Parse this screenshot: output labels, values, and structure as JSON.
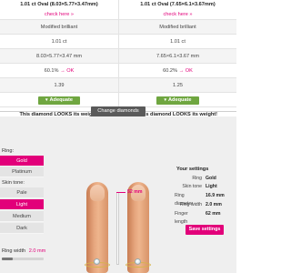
{
  "comparison": [
    {
      "title": "1.01 ct Oval (8.03×5.77×3.47mm)",
      "check_label": "check here »",
      "cut": "Modified brilliant",
      "carat": "1.01 ct",
      "dimensions": "8.03×5.77×3.47 mm",
      "ratio": "60.1%",
      "ratio_arrow": "→",
      "ratio_status": "OK",
      "lw_ratio": "1.39",
      "rating": "Adequate",
      "verdict": "This diamond LOOKS its weight!"
    },
    {
      "title": "1.01 ct Oval (7.65×6.1×3.67mm)",
      "check_label": "check here »",
      "cut": "Modified brilliant",
      "carat": "1.01 ct",
      "dimensions": "7.65×6.1×3.67 mm",
      "ratio": "60.2%",
      "ratio_arrow": "→",
      "ratio_status": "OK",
      "lw_ratio": "1.25",
      "rating": "Adequate",
      "verdict": "This diamond LOOKS its weight!"
    }
  ],
  "change_diamonds_label": "Change diamonds",
  "ring": {
    "label": "Ring:",
    "options": [
      "Gold",
      "Platinum"
    ],
    "selected": "Gold"
  },
  "skin_tone": {
    "label": "Skin tone:",
    "options": [
      "Pale",
      "Light",
      "Medium",
      "Dark"
    ],
    "selected": "Light"
  },
  "ring_width": {
    "label": "Ring width",
    "value": "2.0 mm",
    "fraction": 0.25
  },
  "finger_length_indicator": "52 mm",
  "settings": {
    "title": "Your settings",
    "rows": [
      {
        "label": "Ring",
        "value": "Gold"
      },
      {
        "label": "Skin tone",
        "value": "Light"
      },
      {
        "label": "Ring diameter",
        "value": "16.9 mm"
      },
      {
        "label": "Ring width",
        "value": "2.0 mm"
      },
      {
        "label": "Finger length",
        "value": "62 mm"
      }
    ],
    "save_label": "Save settings"
  },
  "colors": {
    "accent": "#e2007a",
    "adequate": "#6fa640",
    "gold": "#d6b44a"
  }
}
